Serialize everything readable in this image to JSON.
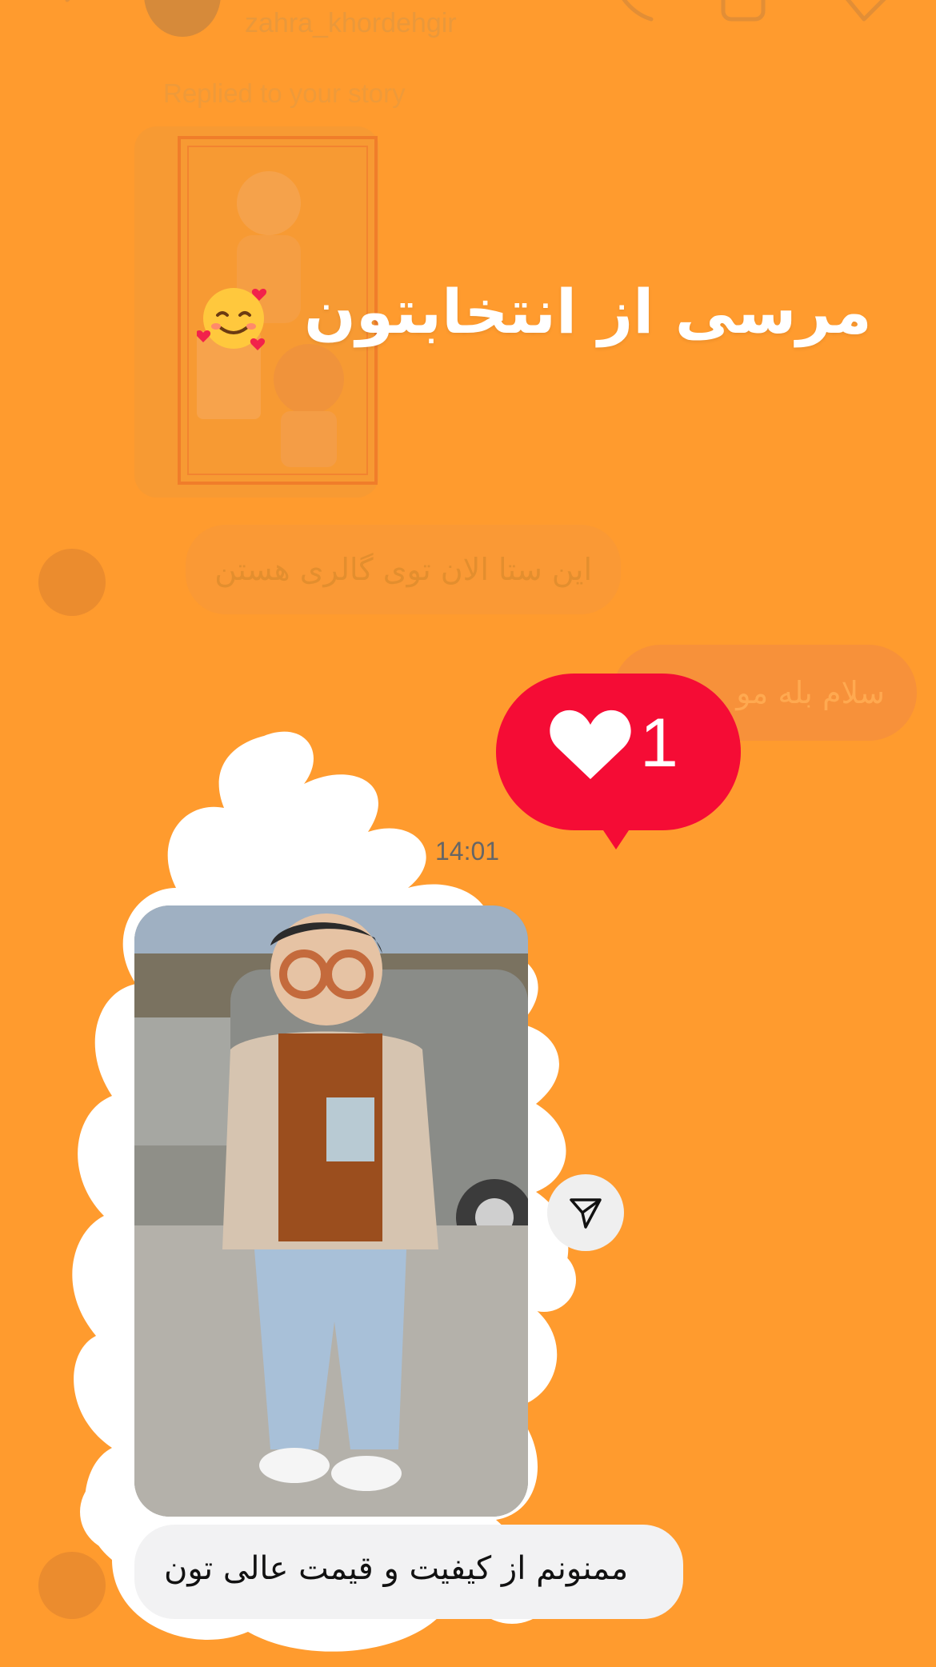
{
  "header": {
    "username": "zahra_khordehgir",
    "icons": [
      "back-icon",
      "phone-icon",
      "video-icon",
      "tag-icon"
    ]
  },
  "story_reply": {
    "label": "Replied to your story",
    "overlay_text": "مرسی از انتخابتون",
    "emoji": "smiling-face-with-hearts"
  },
  "messages": {
    "incoming_1": "این ستا الان توی گالری هستن",
    "outgoing_1": "سلام بله مو",
    "incoming_2": "ممنونم از کیفیت و قیمت عالی تون"
  },
  "reaction": {
    "icon": "heart-icon",
    "count": "1"
  },
  "timestamp": "14:01",
  "share_icon": "send-icon",
  "colors": {
    "background": "#FF9B2E",
    "reaction": "#F50C35",
    "scribble": "#FFFFFF"
  }
}
